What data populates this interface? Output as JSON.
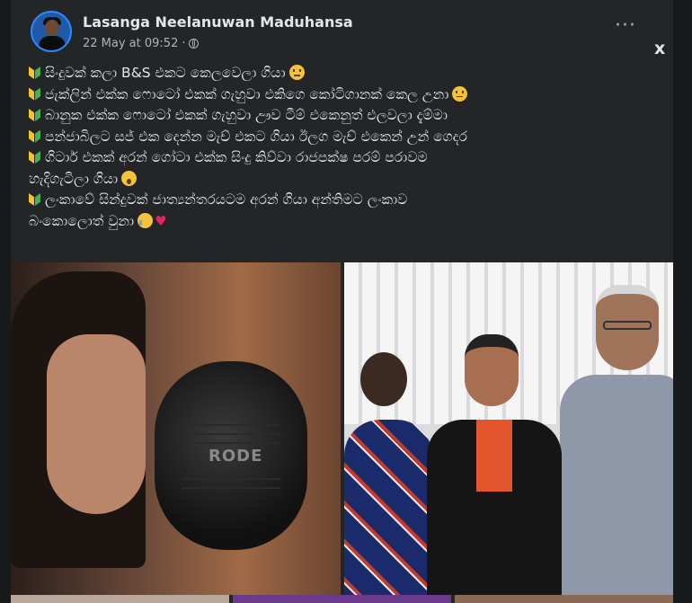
{
  "post": {
    "author": "Lasanga Neelanuwan Maduhansa",
    "timestamp": "22 May at 09:52",
    "separator": "·",
    "privacy_icon": "globe-icon",
    "more_icon": "more-options-icon",
    "more_label": "···",
    "close_label": "x"
  },
  "text_lines": [
    "සිංදුවක් කලා B&S එකට කෙලවෙලා ගියා",
    "ජැක්ලින් එක්ක ෆොටෝ එකක් ගැහුවා එකිගෙ කෝටිගානක් කෙල උනා",
    "බානුක එක්ක ෆොටෝ එකක් ගැහුවා ඌව ටීම් එකෙනුත් එලවලා දැම්මා",
    "පන්ජාබිලට සජ් එක දෙන්න මැච් එකට ගියා ඊලග මැච් එකෙන් උන් ගෙදර",
    "ගිටාර් එකක් අරන් ගෝටා එක්ක සිංදු කිව්වා රාජපක්ෂ පරම් පරාවම",
    "හැදිගැටිලා ගියා",
    "ලංකාවේ සින්දුවක් ජාත්‍යන්තරයටම අරන් ගියා අන්තිමට ලංකාව",
    "බංකොලොත් වුනා"
  ],
  "photos": {
    "left_mic_brand": "RODE"
  },
  "colors": {
    "background": "#18191a",
    "card": "#242526",
    "text": "#e4e6eb",
    "secondary_text": "#b0b3b8"
  }
}
